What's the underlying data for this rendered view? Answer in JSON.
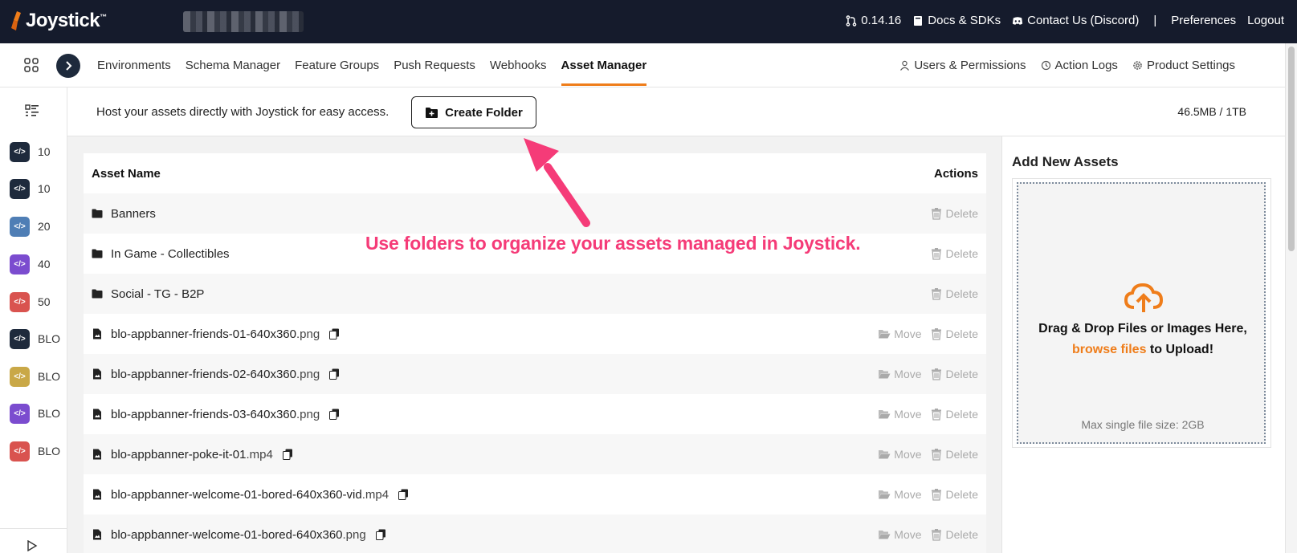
{
  "app": {
    "logo_text": "Joystick",
    "logo_tm": "™"
  },
  "topnav": {
    "version": "0.14.16",
    "docs": "Docs & SDKs",
    "contact": "Contact Us (Discord)",
    "separator": "|",
    "preferences": "Preferences",
    "logout": "Logout"
  },
  "tabs": [
    {
      "label": "Environments"
    },
    {
      "label": "Schema Manager"
    },
    {
      "label": "Feature Groups"
    },
    {
      "label": "Push Requests"
    },
    {
      "label": "Webhooks"
    },
    {
      "label": "Asset Manager"
    }
  ],
  "rightnav": {
    "users": "Users & Permissions",
    "logs": "Action Logs",
    "settings": "Product Settings"
  },
  "sidebar": {
    "items": [
      {
        "label": "10",
        "color": "#1e2a3c"
      },
      {
        "label": "10",
        "color": "#1e2a3c"
      },
      {
        "label": "20",
        "color": "#4f7eb5"
      },
      {
        "label": "40",
        "color": "#7b4ccf"
      },
      {
        "label": "50",
        "color": "#d9534f"
      },
      {
        "label": "BLO",
        "color": "#1e2a3c"
      },
      {
        "label": "BLO",
        "color": "#c9a847"
      },
      {
        "label": "BLO",
        "color": "#7b4ccf"
      },
      {
        "label": "BLO",
        "color": "#d9534f"
      }
    ]
  },
  "host": {
    "text": "Host your assets directly with Joystick for easy access.",
    "create_label": "Create Folder",
    "storage": "46.5MB / 1TB"
  },
  "table": {
    "col_name": "Asset Name",
    "col_actions": "Actions",
    "move_label": "Move",
    "delete_label": "Delete",
    "rows": [
      {
        "name": "Banners",
        "ext": ""
      },
      {
        "name": "In Game - Collectibles",
        "ext": ""
      },
      {
        "name": "Social - TG - B2P",
        "ext": ""
      },
      {
        "name": "blo-appbanner-friends-01-640x360",
        "ext": ".png"
      },
      {
        "name": "blo-appbanner-friends-02-640x360",
        "ext": ".png"
      },
      {
        "name": "blo-appbanner-friends-03-640x360",
        "ext": ".png"
      },
      {
        "name": "blo-appbanner-poke-it-01",
        "ext": ".mp4"
      },
      {
        "name": "blo-appbanner-welcome-01-bored-640x360-vid",
        "ext": ".mp4"
      },
      {
        "name": "blo-appbanner-welcome-01-bored-640x360",
        "ext": ".png"
      }
    ]
  },
  "upload": {
    "title": "Add New Assets",
    "line1": "Drag & Drop Files or Images Here,",
    "browse": "browse files",
    "line2_suffix": "to Upload!",
    "max_size": "Max single file size: 2GB"
  },
  "annotation": {
    "text": "Use folders to organize your assets managed in Joystick."
  },
  "colors": {
    "accent": "#ef7d1a",
    "annotation": "#f53b78",
    "topbar": "#151b2c"
  }
}
